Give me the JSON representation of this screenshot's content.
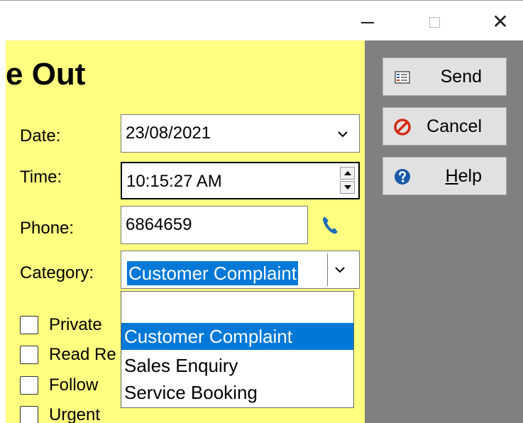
{
  "window": {
    "title": "e Out",
    "controls": [
      "minimize",
      "maximize",
      "close"
    ],
    "close_glyph": "✕"
  },
  "form": {
    "background": "#ffff80",
    "date": {
      "label": "Date:",
      "value": "23/08/2021",
      "dropdown_glyph": "⌄"
    },
    "time": {
      "label": "Time:",
      "value": "10:15:27 AM"
    },
    "phone": {
      "label": "Phone:",
      "value": "6864659",
      "icon": "phone-icon"
    },
    "category": {
      "label": "Category:",
      "value": "Customer Complaint",
      "dropdown_glyph": "⌄",
      "options": [
        "",
        "Customer Complaint",
        "Sales Enquiry",
        "Service Booking"
      ],
      "selected_index": 1
    },
    "checkboxes": [
      "Private",
      "Read Re",
      "Follow",
      "Urgent"
    ]
  },
  "side": {
    "background": "#808080",
    "buttons": {
      "send": {
        "label": "Send",
        "icon": "send-icon"
      },
      "cancel": {
        "label": "Cancel",
        "icon": "cancel-icon"
      },
      "help": {
        "label_mnemonic": "H",
        "label_rest": "elp",
        "icon": "help-icon"
      }
    }
  },
  "colors": {
    "selection": "#0078d7",
    "cancel_red": "#d42a17",
    "help_blue": "#1a5aa8",
    "phone_blue": "#1f6fb8"
  }
}
